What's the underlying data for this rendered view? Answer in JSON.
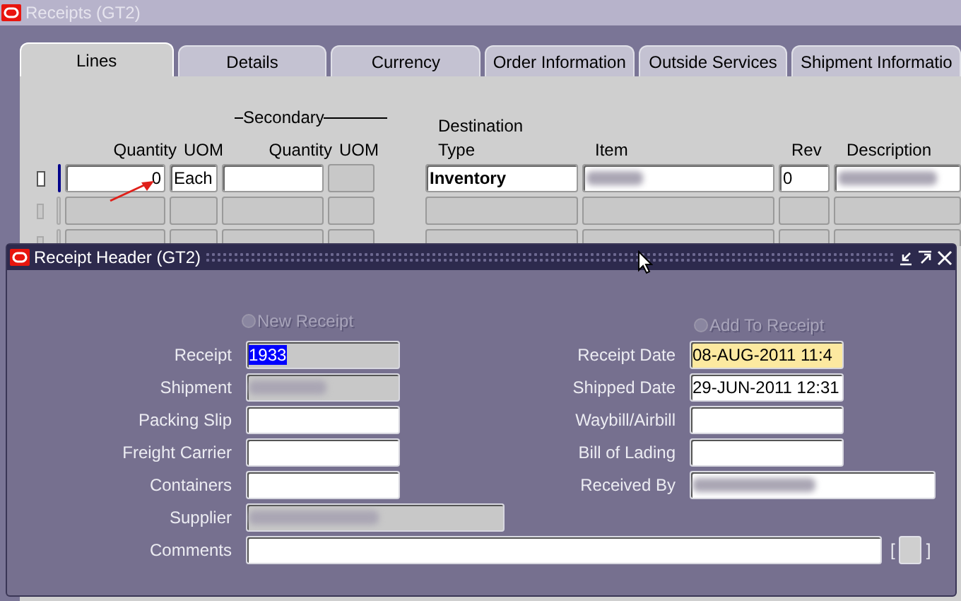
{
  "window": {
    "title": "Receipts (GT2)"
  },
  "tabs": [
    {
      "label": "Lines",
      "selected": true
    },
    {
      "label": "Details",
      "selected": false
    },
    {
      "label": "Currency",
      "selected": false
    },
    {
      "label": "Order Information",
      "selected": false
    },
    {
      "label": "Outside Services",
      "selected": false
    },
    {
      "label": "Shipment Informatio",
      "selected": false
    }
  ],
  "lines": {
    "headers": {
      "quantity": "Quantity",
      "uom": "UOM",
      "secondary": "Secondary",
      "secondary_quantity": "Quantity",
      "secondary_uom": "UOM",
      "destination": "Destination",
      "type": "Type",
      "item": "Item",
      "rev": "Rev",
      "description": "Description"
    },
    "rows": [
      {
        "current": true,
        "quantity": "0",
        "uom": "Each",
        "destination_type": "Inventory",
        "item_redacted": true,
        "rev": "0",
        "description_redacted": true
      },
      {
        "current": false
      },
      {
        "current": false
      }
    ]
  },
  "dialog": {
    "title": "Receipt Header (GT2)",
    "options": [
      {
        "label": "New Receipt",
        "selected": false,
        "disabled": true
      },
      {
        "label": "Add To Receipt",
        "selected": false,
        "disabled": true
      }
    ],
    "rows": [
      {
        "left": {
          "label": "Receipt",
          "value": "1933",
          "value_selected": true,
          "kind": "readonly"
        },
        "right": {
          "label": "Receipt Date",
          "value": "08-AUG-2011 11:4",
          "value_selected": false,
          "kind": "required"
        }
      },
      {
        "left": {
          "label": "Shipment",
          "redacted": true,
          "kind": "readonly"
        },
        "right": {
          "label": "Shipped Date",
          "value": "29-JUN-2011 12:31",
          "value_selected": false,
          "kind": "editable"
        }
      },
      {
        "left": {
          "label": "Packing Slip",
          "kind": "editable"
        },
        "right": {
          "label": "Waybill/Airbill",
          "kind": "editable"
        }
      },
      {
        "left": {
          "label": "Freight Carrier",
          "kind": "editable"
        },
        "right": {
          "label": "Bill of Lading",
          "kind": "editable"
        }
      },
      {
        "left": {
          "label": "Containers",
          "kind": "editable"
        },
        "right": {
          "label": "Received By",
          "redacted": true,
          "kind": "editable"
        }
      },
      {
        "left": {
          "label": "Supplier",
          "redacted": true,
          "kind": "readonly"
        }
      },
      {
        "left": {
          "label": "Comments",
          "kind": "editable",
          "brackets": [
            "[",
            "]"
          ]
        }
      }
    ]
  }
}
